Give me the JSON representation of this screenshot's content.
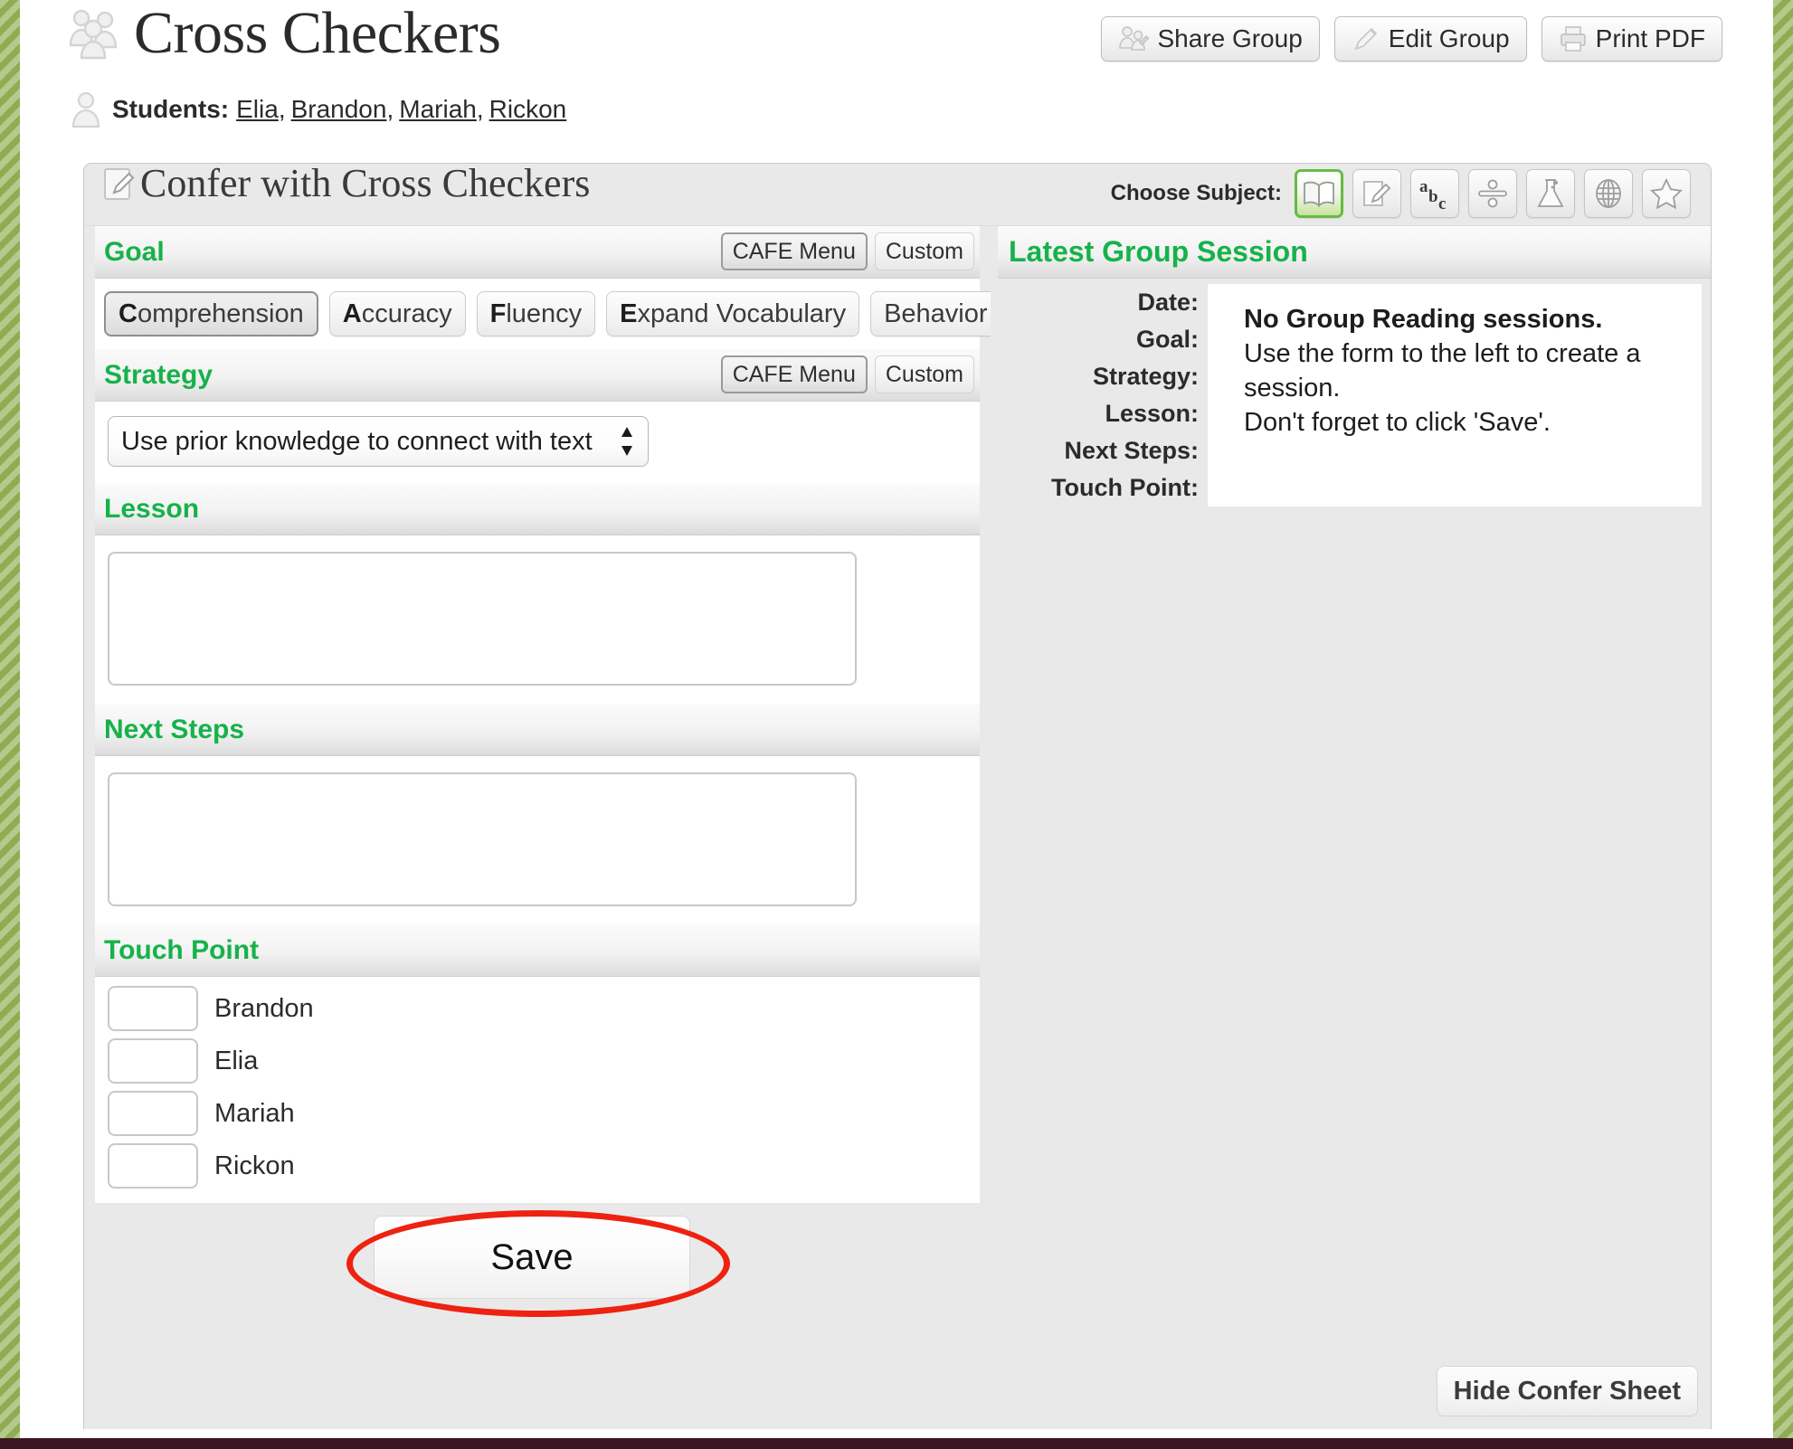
{
  "header": {
    "group_title": "Cross Checkers",
    "group_icon": "group-icon",
    "students_label": "Students:",
    "student_icon": "person-icon",
    "students": [
      "Elia",
      "Brandon",
      "Mariah",
      "Rickon"
    ],
    "actions": [
      {
        "label": "Share Group",
        "icon": "share-group-icon"
      },
      {
        "label": "Edit Group",
        "icon": "pencil-icon"
      },
      {
        "label": "Print PDF",
        "icon": "printer-icon"
      }
    ]
  },
  "confer": {
    "title": "Confer with Cross Checkers",
    "title_icon": "note-pencil-icon",
    "choose_subject_label": "Choose Subject:",
    "subjects": [
      {
        "name": "reading",
        "icon": "open-book-icon",
        "selected": true
      },
      {
        "name": "writing",
        "icon": "paper-pencil-icon",
        "selected": false
      },
      {
        "name": "word-work",
        "icon": "abc-icon",
        "selected": false
      },
      {
        "name": "math",
        "icon": "division-icon",
        "selected": false
      },
      {
        "name": "science",
        "icon": "flask-icon",
        "selected": false
      },
      {
        "name": "social-studies",
        "icon": "globe-icon",
        "selected": false
      },
      {
        "name": "other",
        "icon": "star-icon",
        "selected": false
      }
    ]
  },
  "goal": {
    "heading": "Goal",
    "cafe_menu_label": "CAFE Menu",
    "custom_label": "Custom",
    "cafe_menu_active": true,
    "options": [
      {
        "letter": "C",
        "rest": "omprehension",
        "selected": true
      },
      {
        "letter": "A",
        "rest": "ccuracy",
        "selected": false
      },
      {
        "letter": "F",
        "rest": "luency",
        "selected": false
      },
      {
        "letter": "E",
        "rest": "xpand Vocabulary",
        "selected": false
      },
      {
        "letter": "",
        "rest": "Behavior",
        "selected": false
      }
    ]
  },
  "strategy": {
    "heading": "Strategy",
    "cafe_menu_label": "CAFE Menu",
    "custom_label": "Custom",
    "cafe_menu_active": true,
    "selected_value": "Use prior knowledge to connect with text"
  },
  "lesson": {
    "heading": "Lesson",
    "value": ""
  },
  "next_steps": {
    "heading": "Next Steps",
    "value": ""
  },
  "touch_point": {
    "heading": "Touch Point",
    "rows": [
      {
        "name": "Brandon",
        "value": ""
      },
      {
        "name": "Elia",
        "value": ""
      },
      {
        "name": "Mariah",
        "value": ""
      },
      {
        "name": "Rickon",
        "value": ""
      }
    ]
  },
  "save": {
    "label": "Save",
    "annotation_color": "#ee2211"
  },
  "latest_session": {
    "heading": "Latest Group Session",
    "labels": [
      "Date:",
      "Goal:",
      "Strategy:",
      "Lesson:",
      "Next Steps:",
      "Touch Point:"
    ],
    "empty_title": "No Group Reading sessions.",
    "empty_line1": "Use the form to the left to create a session.",
    "empty_line2": "Don't forget to click 'Save'."
  },
  "footer": {
    "hide_confer_sheet_label": "Hide Confer Sheet"
  },
  "theme": {
    "accent_green": "#16b24a",
    "frame_green": "#8fac52",
    "panel_gray": "#e9e9e9"
  }
}
